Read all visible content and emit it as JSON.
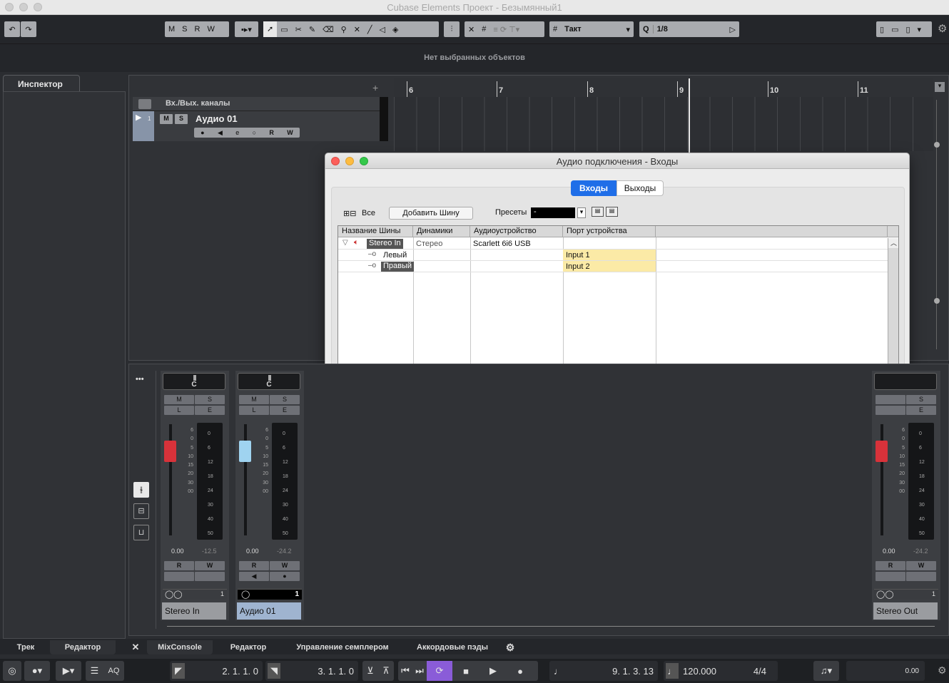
{
  "window": {
    "title": "Cubase Elements Проект - Безымянный1"
  },
  "toolbar": {
    "mute": "M",
    "solo": "S",
    "read": "R",
    "write": "W",
    "grid_type": "Такт",
    "quantize_label": "Q",
    "quantize_value": "1/8"
  },
  "infoline": {
    "text": "Нет выбранных объектов"
  },
  "inspector": {
    "tab": "Инспектор"
  },
  "tracks": {
    "folder_name": "Вх./Вых. каналы",
    "audio_track": {
      "number": "1",
      "name": "Аудио 01",
      "m": "M",
      "s": "S",
      "r": "R",
      "w": "W"
    },
    "add_symbol": "+"
  },
  "ruler": {
    "bars": [
      "6",
      "7",
      "8",
      "9",
      "10",
      "11"
    ]
  },
  "dialog": {
    "title": "Аудио подключения - Входы",
    "tab_inputs": "Входы",
    "tab_outputs": "Выходы",
    "all_label": "Все",
    "add_bus": "Добавить Шину",
    "presets_label": "Пресеты",
    "presets_value": "-",
    "columns": [
      "Название Шины",
      "Динамики",
      "Аудиоустройство",
      "Порт устройства"
    ],
    "rows": [
      {
        "name": "Stereo In",
        "speakers": "Стерео",
        "device": "Scarlett 6i6 USB",
        "port": ""
      },
      {
        "name": "Левый",
        "speakers": "",
        "device": "",
        "port": "Input 1"
      },
      {
        "name": "Правый",
        "speakers": "",
        "device": "",
        "port": "Input 2"
      }
    ]
  },
  "mixer": {
    "dots": "•••",
    "strips": [
      {
        "name": "Stereo In",
        "pan": "C",
        "m": "M",
        "s": "S",
        "l": "L",
        "e": "E",
        "vol": "0.00",
        "peak": "-12.5",
        "r": "R",
        "w": "W",
        "num": "1"
      },
      {
        "name": "Аудио 01",
        "pan": "C",
        "m": "M",
        "s": "S",
        "l": "L",
        "e": "E",
        "vol": "0.00",
        "peak": "-24.2",
        "r": "R",
        "w": "W",
        "num": "1"
      },
      {
        "name": "Stereo Out",
        "pan": "",
        "m": "",
        "s": "S",
        "l": "",
        "e": "E",
        "vol": "0.00",
        "peak": "-24.2",
        "r": "R",
        "w": "W",
        "num": "1"
      }
    ],
    "fader_scale": [
      "6",
      "0",
      "5",
      "10",
      "15",
      "20",
      "30",
      "00"
    ],
    "meter_scale": [
      "0",
      "6",
      "12",
      "18",
      "24",
      "30",
      "40",
      "50"
    ]
  },
  "bottom_tabs": {
    "track": "Трек",
    "editor_left": "Редактор",
    "mixconsole": "MixConsole",
    "editor": "Редактор",
    "sampler": "Управление семплером",
    "chord": "Аккордовые пэды"
  },
  "transport": {
    "left_locator": "2. 1. 1.   0",
    "right_locator": "3. 1. 1.   0",
    "aq": "AQ",
    "position": "9. 1. 3. 13",
    "tempo": "120.000",
    "signature": "4/4",
    "output": "0.00"
  },
  "colors": {
    "accent": "#1f6ee8",
    "fader_red": "#d8323a",
    "fader_blue": "#9fd3f0",
    "port_yellow": "#fbeaa6"
  }
}
